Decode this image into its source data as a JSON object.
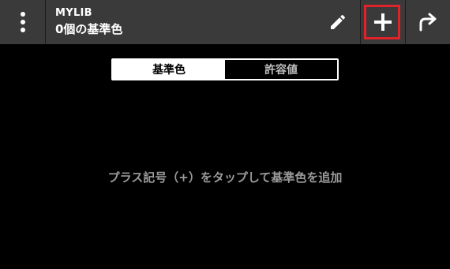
{
  "header": {
    "app_name": "MYLIB",
    "subtitle": "0個の基準色",
    "icons": {
      "menu": "more-vert-icon",
      "edit": "pencil-icon",
      "add": "plus-icon",
      "share": "share-arrow-icon"
    },
    "background": "#3a3a3a",
    "highlight_color": "#e0232a"
  },
  "tabs": [
    {
      "label": "基準色",
      "active": true
    },
    {
      "label": "許容値",
      "active": false
    }
  ],
  "empty_state": {
    "message": "プラス記号（+）をタップして基準色を追加"
  }
}
